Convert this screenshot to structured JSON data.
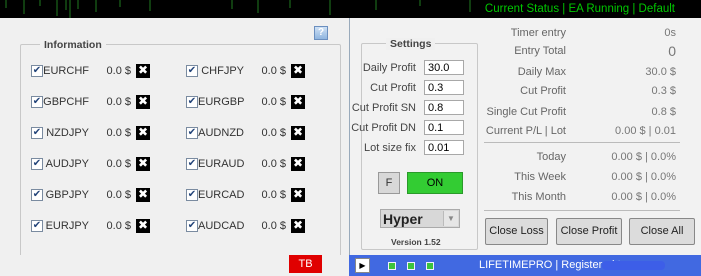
{
  "status_bar": {
    "text": "Current Status | EA Running | Default"
  },
  "info": {
    "title": "Information",
    "help_label": "?",
    "pairs_left": [
      {
        "symbol": "EURCHF",
        "value": "0.0 $"
      },
      {
        "symbol": "GBPCHF",
        "value": "0.0 $"
      },
      {
        "symbol": "NZDJPY",
        "value": "0.0 $"
      },
      {
        "symbol": "AUDJPY",
        "value": "0.0 $"
      },
      {
        "symbol": "GBPJPY",
        "value": "0.0 $"
      },
      {
        "symbol": "EURJPY",
        "value": "0.0 $"
      }
    ],
    "pairs_right": [
      {
        "symbol": "CHFJPY",
        "value": "0.0 $"
      },
      {
        "symbol": "EURGBP",
        "value": "0.0 $"
      },
      {
        "symbol": "AUDNZD",
        "value": "0.0 $"
      },
      {
        "symbol": "EURAUD",
        "value": "0.0 $"
      },
      {
        "symbol": "EURCAD",
        "value": "0.0 $"
      },
      {
        "symbol": "AUDCAD",
        "value": "0.0 $"
      }
    ],
    "check_glyph": "✔",
    "close_glyph": "✖"
  },
  "settings": {
    "title": "Settings",
    "fields": [
      {
        "label": "Daily Profit",
        "value": "30.0"
      },
      {
        "label": "Cut Profit",
        "value": "0.3"
      },
      {
        "label": "Cut Profit SN",
        "value": "0.8"
      },
      {
        "label": "Cut Profit DN",
        "value": "0.1"
      },
      {
        "label": "Lot size fix",
        "value": "0.01"
      }
    ],
    "f_label": "F",
    "on_label": "ON",
    "mode": "Hyper",
    "mode_arrow": "▼",
    "version": "Version 1.52"
  },
  "stats": [
    {
      "label": "Timer entry",
      "value": "0s"
    },
    {
      "label": "Entry Total",
      "value": "0"
    },
    {
      "label": "Daily Max",
      "value": "30.0 $"
    },
    {
      "label": "Cut Profit",
      "value": "0.3 $"
    },
    {
      "label": "Single Cut Profit",
      "value": "0.8 $"
    },
    {
      "label": "Current P/L | Lot",
      "value": "0.00 $ | 0.01"
    },
    {
      "label": "Today",
      "value": "0.00 $ | 0.0%"
    },
    {
      "label": "This Week",
      "value": "0.00 $ | 0.0%"
    },
    {
      "label": "This Month",
      "value": "0.00 $ | 0.0%"
    }
  ],
  "actions": {
    "close_loss": "Close Loss",
    "close_profit": "Close Profit",
    "close_all": "Close All"
  },
  "footer": {
    "tb_label": "TB",
    "play_glyph": "▶",
    "text": "LIFETIMEPRO | Registered to"
  },
  "colors": {
    "status_green": "#00c800",
    "on_green": "#33cc33",
    "tb_red": "#e00000",
    "footer_blue": "#4169e1"
  }
}
